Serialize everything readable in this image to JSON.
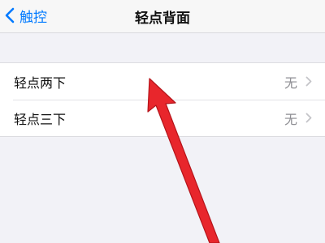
{
  "navbar": {
    "back_label": "触控",
    "title": "轻点背面"
  },
  "settings": {
    "rows": [
      {
        "label": "轻点两下",
        "value": "无"
      },
      {
        "label": "轻点三下",
        "value": "无"
      }
    ]
  },
  "icons": {
    "back": "chevron-left-icon",
    "row_disclosure": "chevron-right-icon",
    "annotation": "red-arrow"
  },
  "colors": {
    "accent": "#007aff",
    "value_gray": "#8e8e93",
    "annotation_red": "#e8262c"
  }
}
